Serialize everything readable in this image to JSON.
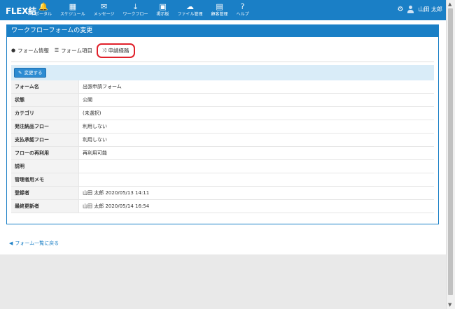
{
  "app": {
    "brand": "FLEX結"
  },
  "nav": [
    {
      "label": "ポータル",
      "icon": "bell-icon",
      "glyph": "🔔"
    },
    {
      "label": "スケジュール",
      "icon": "calendar-icon",
      "glyph": "▦"
    },
    {
      "label": "メッセージ",
      "icon": "mail-icon",
      "glyph": "✉"
    },
    {
      "label": "ワークフロー",
      "icon": "workflow-icon",
      "glyph": "⤓"
    },
    {
      "label": "掲示板",
      "icon": "board-icon",
      "glyph": "▣"
    },
    {
      "label": "ファイル管理",
      "icon": "cloud-icon",
      "glyph": "☁"
    },
    {
      "label": "顧客管理",
      "icon": "book-icon",
      "glyph": "▤"
    },
    {
      "label": "ヘルプ",
      "icon": "help-icon",
      "glyph": "?"
    }
  ],
  "user": {
    "name": "山田 太郎"
  },
  "panel": {
    "title": "ワークフローフォームの変更"
  },
  "tabs": [
    {
      "label": "フォーム情報",
      "glyph": "●"
    },
    {
      "label": "フォーム項目",
      "glyph": "☰"
    },
    {
      "label": "申請経路",
      "glyph": "⤨"
    }
  ],
  "actions": {
    "edit_label": "変更する"
  },
  "rows": [
    {
      "key": "フォーム名",
      "value": "出張申請フォーム"
    },
    {
      "key": "状態",
      "value": "公開"
    },
    {
      "key": "カテゴリ",
      "value": "(未選択)"
    },
    {
      "key": "発注納品フロー",
      "value": "利用しない"
    },
    {
      "key": "支払承認フロー",
      "value": "利用しない"
    },
    {
      "key": "フローの再利用",
      "value": "再利用可能"
    },
    {
      "key": "説明",
      "value": ""
    },
    {
      "key": "管理者用メモ",
      "value": ""
    },
    {
      "key": "登録者",
      "value": "山田 太郎 2020/05/13 14:11"
    },
    {
      "key": "最終更新者",
      "value": "山田 太郎 2020/05/14 16:54"
    }
  ],
  "footer": {
    "back_label": "フォーム一覧に戻る"
  },
  "colors": {
    "primary": "#1a7fc6",
    "highlight": "#e0202a",
    "bar": "#d9ecf8"
  }
}
